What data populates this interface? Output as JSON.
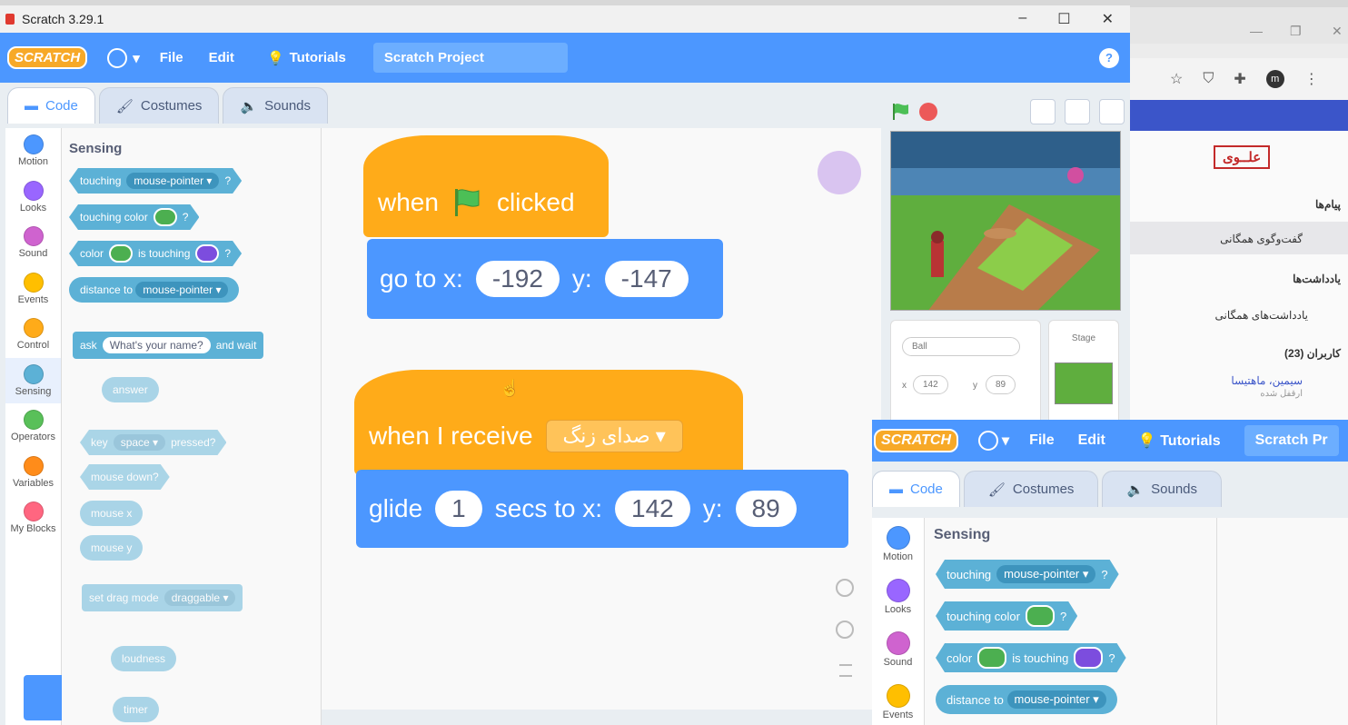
{
  "window": {
    "title": "Scratch 3.29.1",
    "controls": [
      "–",
      "☐",
      "✕"
    ]
  },
  "menubar": {
    "logo": "SCRATCH",
    "file": "File",
    "edit": "Edit",
    "tutorials": "Tutorials",
    "project_title": "Scratch Project",
    "help": "?"
  },
  "tabs": {
    "code": "Code",
    "costumes": "Costumes",
    "sounds": "Sounds"
  },
  "categories": [
    {
      "label": "Motion",
      "color": "#4c97ff"
    },
    {
      "label": "Looks",
      "color": "#9966ff"
    },
    {
      "label": "Sound",
      "color": "#cf63cf"
    },
    {
      "label": "Events",
      "color": "#ffbf00"
    },
    {
      "label": "Control",
      "color": "#ffab19"
    },
    {
      "label": "Sensing",
      "color": "#5cb1d6"
    },
    {
      "label": "Operators",
      "color": "#59c059"
    },
    {
      "label": "Variables",
      "color": "#ff8c1a"
    },
    {
      "label": "My Blocks",
      "color": "#ff6680"
    }
  ],
  "palette": {
    "title": "Sensing",
    "touching": "touching",
    "mouse_pointer": "mouse-pointer",
    "q": "?",
    "touching_color": "touching color",
    "color": "color",
    "is_touching": "is touching",
    "distance_to": "distance to",
    "ask": "ask",
    "ask_default": "What's your name?",
    "and_wait": "and wait",
    "answer": "answer",
    "key": "key",
    "space": "space",
    "pressed": "pressed?",
    "mouse_down": "mouse down?",
    "mouse_x": "mouse x",
    "mouse_y": "mouse y",
    "set_drag": "set drag mode",
    "draggable": "draggable",
    "loudness": "loudness",
    "timer": "timer"
  },
  "script1": {
    "when": "when",
    "clicked": "clicked",
    "goto": "go to x:",
    "x": "-192",
    "y_label": "y:",
    "y": "-147"
  },
  "script2": {
    "when_receive": "when I receive",
    "message": "صدای زنگ",
    "glide": "glide",
    "secs": "1",
    "secs_to": "secs to x:",
    "x": "142",
    "y_label": "y:",
    "y": "89"
  },
  "sprite_info": {
    "name": "Ball",
    "x_label": "x",
    "x": "142",
    "y_label": "y",
    "y": "89",
    "stage_label": "Stage"
  },
  "chrome_side": {
    "logo": "علــوی",
    "messages_header": "پیام‌ها",
    "public_chat": "گفت‌وگوی همگانی",
    "notes_header": "یادداشت‌ها",
    "public_notes": "یادداشت‌های همگانی",
    "users_header": "کاربران (23)",
    "user_name": "سیمین، ماهتیسا",
    "user_status": "ارقفل شده"
  },
  "overlay": {
    "logo": "SCRATCH",
    "file": "File",
    "edit": "Edit",
    "tutorials": "Tutorials",
    "project_title": "Scratch Pr",
    "code": "Code",
    "costumes": "Costumes",
    "sounds": "Sounds",
    "pal_title": "Sensing",
    "cats": [
      "Motion",
      "Looks",
      "Sound",
      "Events"
    ]
  }
}
